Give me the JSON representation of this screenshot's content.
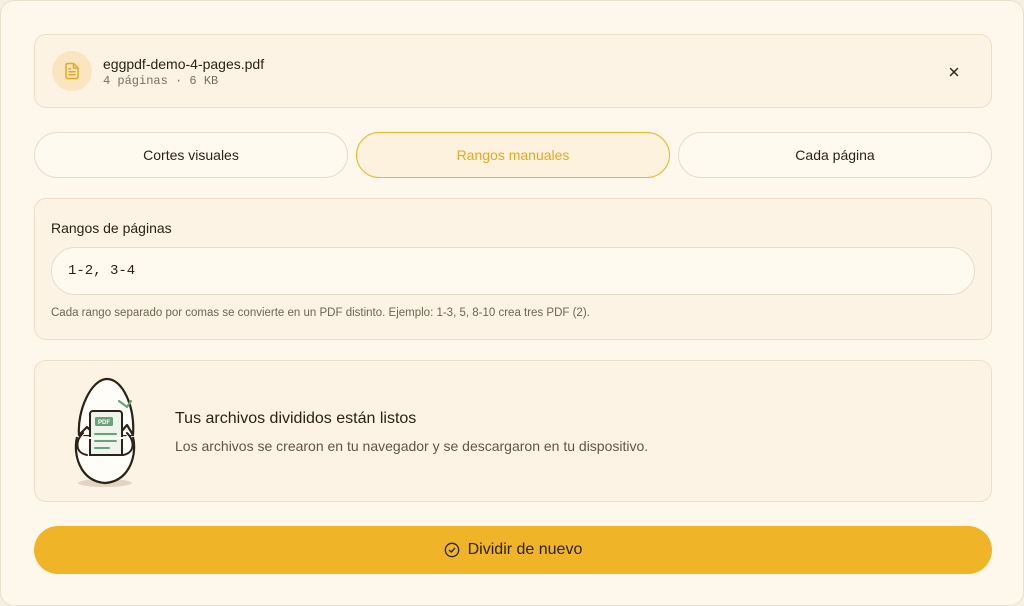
{
  "file": {
    "name": "eggpdf-demo-4-pages.pdf",
    "meta": "4 páginas · 6 KB",
    "icon": "file-text-icon",
    "close_icon": "close-icon"
  },
  "tabs": [
    {
      "label": "Cortes visuales",
      "active": false
    },
    {
      "label": "Rangos manuales",
      "active": true
    },
    {
      "label": "Cada página",
      "active": false
    }
  ],
  "ranges": {
    "label": "Rangos de páginas",
    "value": "1-2, 3-4",
    "help": "Cada rango separado por comas se convierte en un PDF distinto. Ejemplo: 1-3, 5, 8-10 crea tres PDF (2)."
  },
  "result": {
    "badge": "PDF",
    "title": "Tus archivos divididos están listos",
    "subtitle": "Los archivos se crearon en tu navegador y se descargaron en tu dispositivo."
  },
  "action": {
    "label": "Dividir de nuevo",
    "icon": "check-circle-icon"
  },
  "colors": {
    "accent": "#f0b429",
    "background": "#fef8ec"
  }
}
